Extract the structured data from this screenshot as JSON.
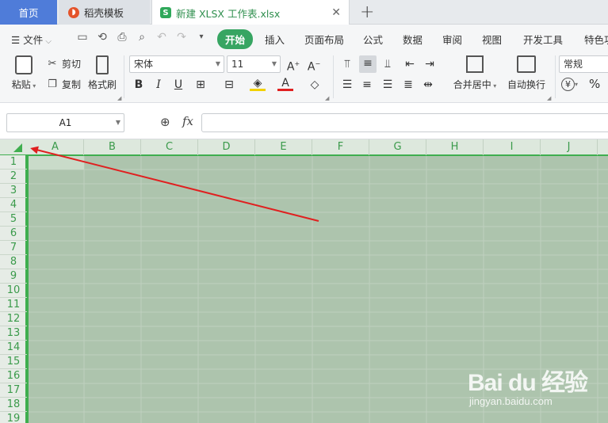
{
  "tabs": [
    {
      "label": "首页",
      "active": false
    },
    {
      "label": "稻壳模板",
      "active": false
    },
    {
      "label": "新建 XLSX 工作表.xlsx",
      "active": true
    }
  ],
  "menu": {
    "file_label": "文件",
    "items": [
      "开始",
      "插入",
      "页面布局",
      "公式",
      "数据",
      "审阅",
      "视图",
      "开发工具",
      "特色功"
    ]
  },
  "ribbon": {
    "paste_label": "粘贴",
    "cut_label": "剪切",
    "copy_label": "复制",
    "format_painter_label": "格式刷",
    "font_name": "宋体",
    "font_size": "11",
    "merge_center_label": "合并居中",
    "wrap_text_label": "自动换行",
    "number_format": "常规",
    "currency_symbol": "¥",
    "percent_symbol": "%"
  },
  "formula_bar": {
    "cell_ref": "A1",
    "fx_label": "fx",
    "formula_value": ""
  },
  "grid": {
    "columns": [
      "A",
      "B",
      "C",
      "D",
      "E",
      "F",
      "G",
      "H",
      "I",
      "J"
    ],
    "rows": [
      "1",
      "2",
      "3",
      "4",
      "5",
      "6",
      "7",
      "8",
      "9",
      "10",
      "11",
      "12",
      "13",
      "14",
      "15",
      "16",
      "17",
      "18",
      "19"
    ]
  },
  "watermark": {
    "brand": "Bai du 经验",
    "url": "jingyan.baidu.com"
  },
  "colors": {
    "accent": "#37a562",
    "selection": "#adc4ad",
    "header_text": "#3a9a4a",
    "arrow": "#e02020"
  }
}
